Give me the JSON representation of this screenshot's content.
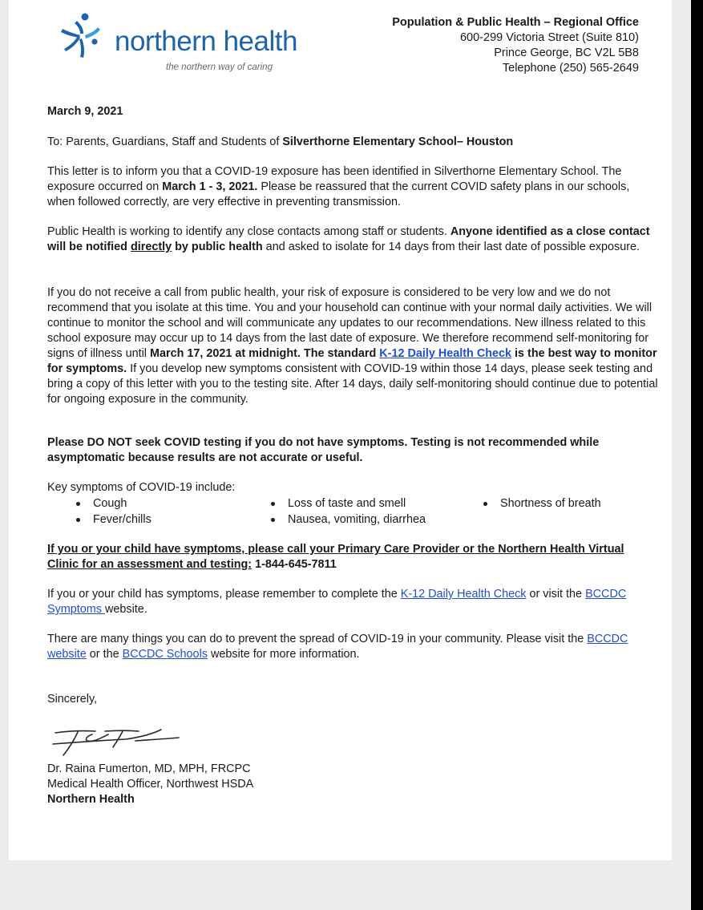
{
  "logo": {
    "name": "northern health",
    "tagline": "the northern way of caring",
    "brand_color": "#1f63ad",
    "icon": "northern-health-figure-logo"
  },
  "office": {
    "name": "Population & Public Health – Regional Office",
    "street": "600-299 Victoria Street (Suite 810)",
    "city": "Prince George, BC V2L 5B8",
    "telephone": "Telephone (250) 565-2649"
  },
  "letter": {
    "date": "March 9, 2021",
    "to_prefix": "To: Parents, Guardians, Staff and Students of ",
    "to_school": "Silverthorne Elementary School– Houston",
    "p1": {
      "a": "This letter is to inform you that a COVID-19 exposure has been identified in Silverthorne Elementary School. The exposure occurred on ",
      "dates": "March 1 - 3, 2021.",
      "b": " Please be reassured that the current COVID safety plans in our schools, when followed correctly, are very effective in preventing transmission."
    },
    "p2": {
      "a": "Public Health is working to identify any close contacts among staff or students. ",
      "b1": "Anyone identified as a close contact will be notified ",
      "b_u": "directly",
      "b2": " by public health",
      "c": " and asked to isolate for 14 days from their last date of possible exposure."
    },
    "p3": {
      "a": "If you do not receive a call from public health, your risk of exposure is considered to be very low and we do not recommend that you isolate at this time. You and your household can continue with your normal daily activities. We will continue to monitor the school and will communicate any updates to our recommendations. New illness related to this school exposure may occur up to 14 days from the last date of exposure. We therefore recommend self-monitoring for signs of illness until ",
      "bold_date": "March 17, 2021 at midnight. The standard ",
      "link": "K-12 Daily Health Check",
      "bold_after": " is the best way to monitor for symptoms.",
      "c": " If you develop new symptoms consistent with COVID-19 within those 14 days, please seek testing and bring a copy of this letter with you to the testing site. After 14 days, daily self-monitoring should continue due to potential for ongoing exposure in the community."
    },
    "p4": "Please DO NOT seek COVID testing if you do not have symptoms. Testing is not recommended while asymptomatic because results are not accurate or useful.",
    "symptoms_intro": "Key symptoms of COVID-19 include:",
    "symptoms_col1": [
      "Cough",
      "Fever/chills"
    ],
    "symptoms_col2": [
      "Loss of taste and smell",
      "Nausea, vomiting, diarrhea"
    ],
    "symptoms_col3": [
      "Shortness of breath"
    ],
    "p5": {
      "underlined": "If you or your child have symptoms, please call your Primary Care Provider or the Northern Health Virtual Clinic for an assessment and testing:",
      "phone": " 1-844-645-7811"
    },
    "p6": {
      "a": "If you or your child has symptoms, please remember to complete the ",
      "link1": "K-12 Daily Health Check",
      "b": " or visit the ",
      "link2": "BCCDC Symptoms ",
      "c": "website."
    },
    "p7": {
      "a": "There are many things you can do to prevent the spread of COVID-19 in your community. Please visit the ",
      "link1": "BCCDC website",
      "b": " or the ",
      "link2": "BCCDC Schools",
      "c": " website for more information."
    },
    "closing": "Sincerely,",
    "signer_name": "Dr. Raina Fumerton, MD, MPH, FRCPC",
    "signer_title": "Medical Health Officer, Northwest HSDA",
    "signer_org": "Northern Health",
    "link_color": "#1f4fd1"
  }
}
